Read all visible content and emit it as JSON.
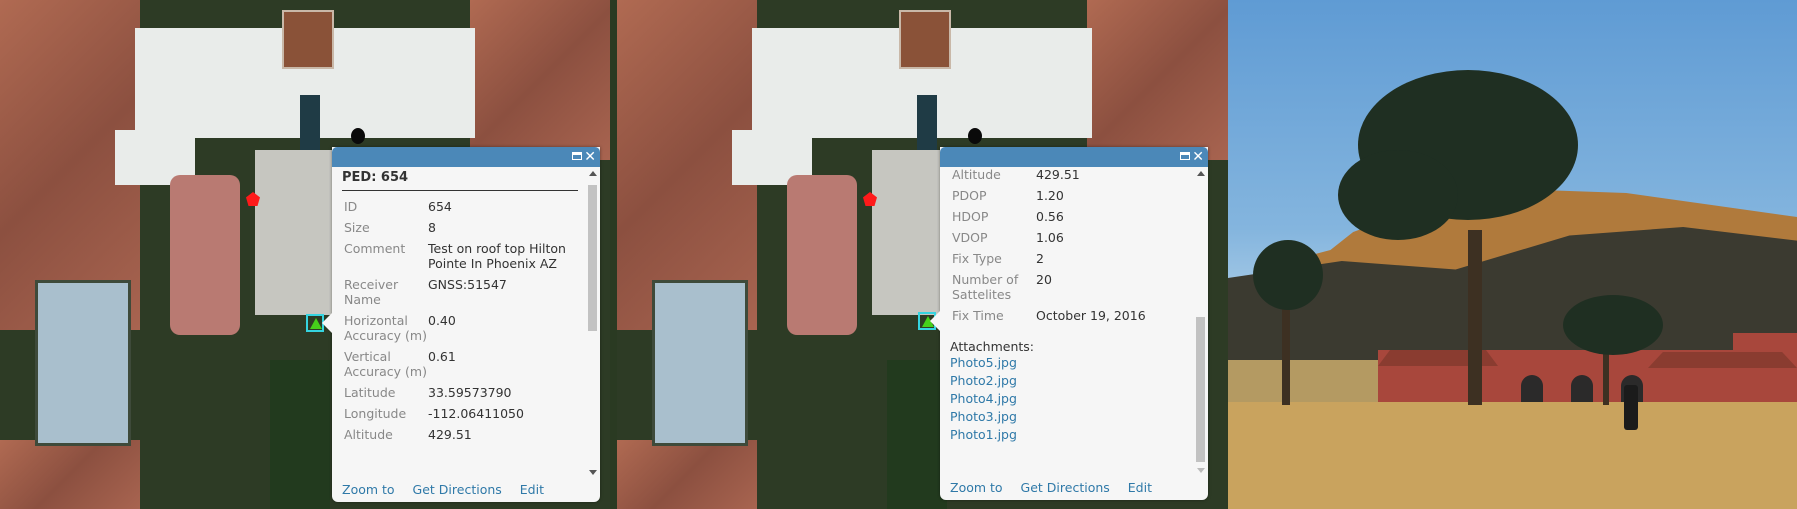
{
  "popup_left": {
    "title": "PED: 654",
    "fields": [
      {
        "label": "ID",
        "value": "654"
      },
      {
        "label": "Size",
        "value": "8"
      },
      {
        "label": "Comment",
        "value": "Test on roof top Hilton Pointe In Phoenix AZ"
      },
      {
        "label": "Receiver Name",
        "value": "GNSS:51547"
      },
      {
        "label": "Horizontal Accuracy (m)",
        "value": "0.40"
      },
      {
        "label": "Vertical Accuracy (m)",
        "value": "0.61"
      },
      {
        "label": "Latitude",
        "value": "33.59573790"
      },
      {
        "label": "Longitude",
        "value": "-112.06411050"
      },
      {
        "label": "Altitude",
        "value": "429.51"
      }
    ],
    "actions": {
      "zoom_to": "Zoom to",
      "get_directions": "Get Directions",
      "edit": "Edit"
    },
    "scroll_position": 0
  },
  "popup_right": {
    "fields": [
      {
        "label": "Altitude",
        "value": "429.51"
      },
      {
        "label": "PDOP",
        "value": "1.20"
      },
      {
        "label": "HDOP",
        "value": "0.56"
      },
      {
        "label": "VDOP",
        "value": "1.06"
      },
      {
        "label": "Fix Type",
        "value": "2"
      },
      {
        "label": "Number of Sattelites",
        "value": "20"
      },
      {
        "label": "Fix Time",
        "value": "October 19, 2016"
      }
    ],
    "attachments_label": "Attachments:",
    "attachments": [
      "Photo5.jpg",
      "Photo2.jpg",
      "Photo4.jpg",
      "Photo3.jpg",
      "Photo1.jpg"
    ],
    "actions": {
      "zoom_to": "Zoom to",
      "get_directions": "Get Directions",
      "edit": "Edit"
    },
    "scroll_position": 1
  },
  "icons": {
    "maximize": "maximize-icon",
    "close": "✕",
    "scroll_up": "scroll-up-arrow",
    "scroll_down": "scroll-down-arrow"
  },
  "colors": {
    "popup_header": "#4b88b8",
    "link": "#2f79a8",
    "selected_marker_outline": "#35d4e0",
    "selected_marker_fill": "#46d01a",
    "point_marker": "#ff1a1a"
  }
}
